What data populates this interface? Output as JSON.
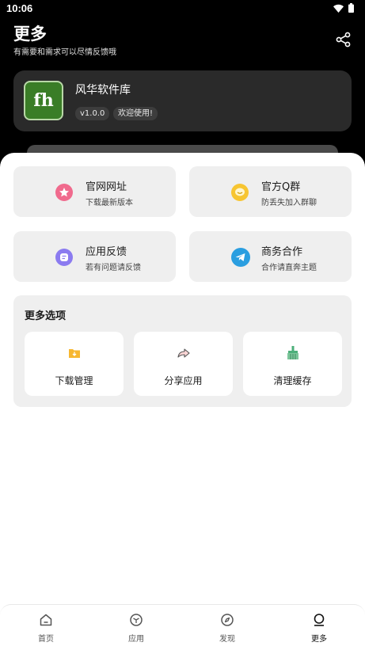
{
  "status_bar": {
    "time": "10:06",
    "icons": [
      "wifi-icon",
      "battery-icon"
    ]
  },
  "header": {
    "title": "更多",
    "subtitle": "有需要和需求可以尽情反馈哦",
    "share_icon": "share-icon"
  },
  "app_card": {
    "logo_text": "fh",
    "name": "风华软件库",
    "version": "v1.0.0",
    "welcome": "欢迎使用!"
  },
  "tiles": [
    {
      "title": "官网网址",
      "subtitle": "下载最新版本",
      "icon": "star-icon",
      "color": "#f06a8d"
    },
    {
      "title": "官方Q群",
      "subtitle": "防丢失加入群聊",
      "icon": "chat-smile-icon",
      "color": "#f7c531"
    },
    {
      "title": "应用反馈",
      "subtitle": "若有问题请反馈",
      "icon": "feedback-icon",
      "color": "#8b7bf0"
    },
    {
      "title": "商务合作",
      "subtitle": "合作请直奔主题",
      "icon": "telegram-icon",
      "color": "#2a9ee0"
    }
  ],
  "more_options": {
    "title": "更多选项",
    "items": [
      {
        "label": "下载管理",
        "icon": "download-folder-icon",
        "color": "#f7b731"
      },
      {
        "label": "分享应用",
        "icon": "share-arrow-icon",
        "color": "#f09a9a"
      },
      {
        "label": "清理缓存",
        "icon": "broom-icon",
        "color": "#4caf7a"
      }
    ]
  },
  "bottom_nav": {
    "items": [
      {
        "label": "首页",
        "icon": "home-icon"
      },
      {
        "label": "应用",
        "icon": "apps-icon"
      },
      {
        "label": "发现",
        "icon": "compass-icon"
      },
      {
        "label": "更多",
        "icon": "user-icon",
        "active": true
      }
    ]
  }
}
